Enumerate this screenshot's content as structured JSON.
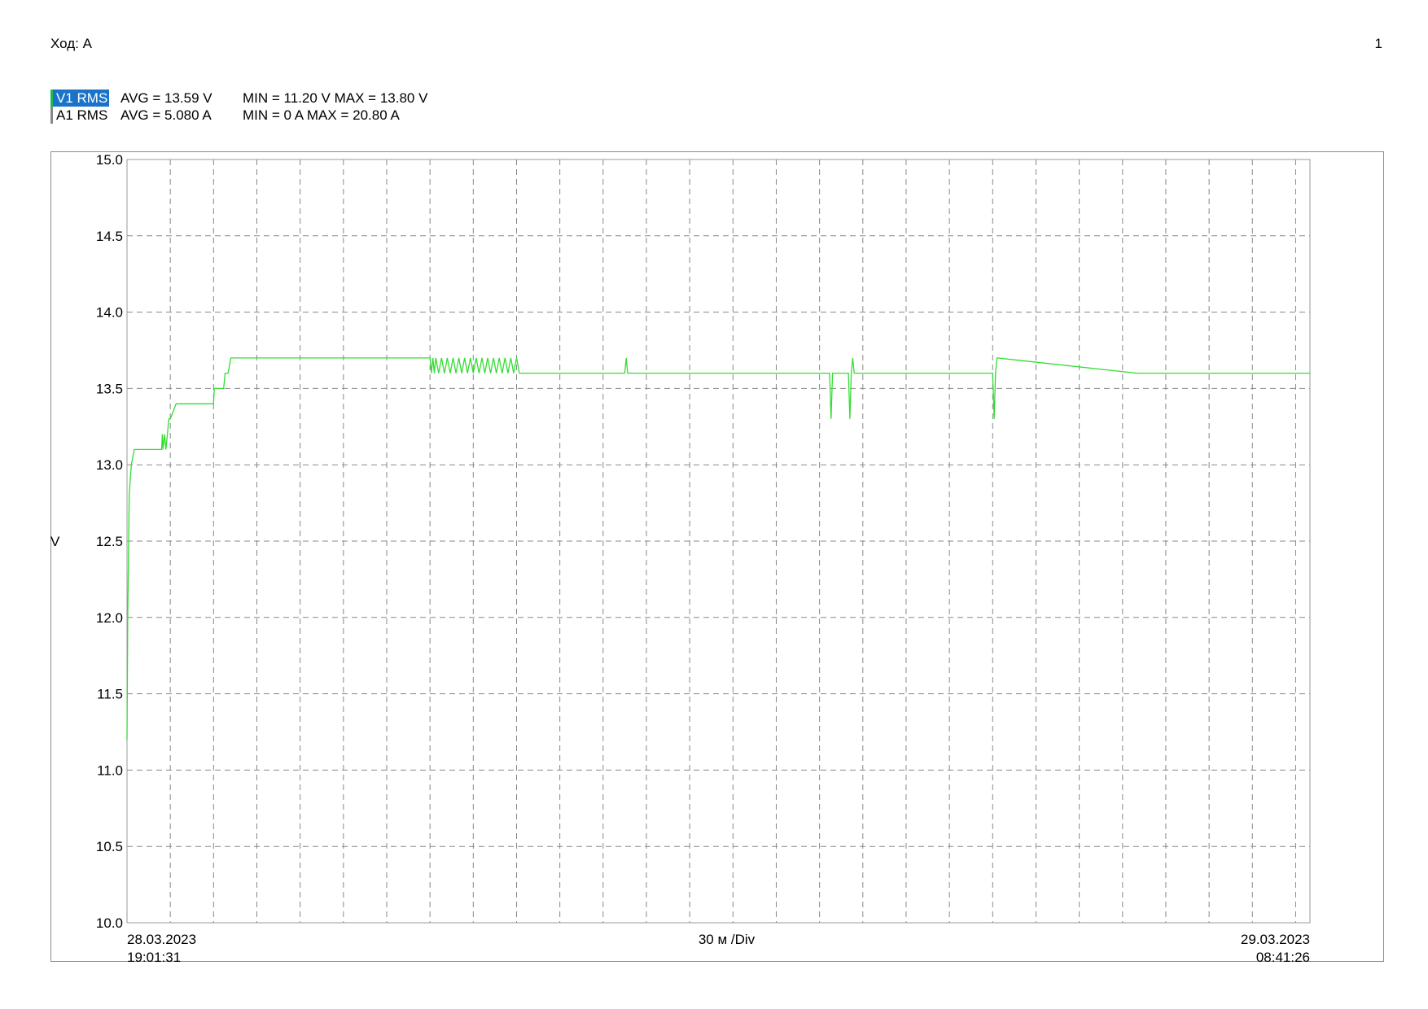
{
  "header": {
    "title": "Ход: A",
    "page_number": "1"
  },
  "legend": [
    {
      "name": "V1 RMS",
      "avg": "AVG = 13.59 V",
      "minmax": "MIN = 11.20 V MAX = 13.80 V",
      "selected": true
    },
    {
      "name": "A1 RMS",
      "avg": "AVG = 5.080 A",
      "minmax": "MIN = 0 A MAX = 20.80 A",
      "selected": false
    }
  ],
  "colors": {
    "series": "#33dd33",
    "grid": "#888888",
    "axes": "#999999",
    "selected_bg": "#1a73c8"
  },
  "chart_data": {
    "type": "line",
    "title": "",
    "ylabel": "V",
    "xlabel": "30 м /Div",
    "ylim": [
      10.0,
      15.0
    ],
    "yticks": [
      "15.0",
      "14.5",
      "14.0",
      "13.5",
      "13.0",
      "12.5",
      "12.0",
      "11.5",
      "11.0",
      "10.5",
      "10.0"
    ],
    "x_start": {
      "date": "28.03.2023",
      "time": "19:01:31"
    },
    "x_end": {
      "date": "29.03.2023",
      "time": "08:41:26"
    },
    "x_unit": "minutes after start",
    "xlim": [
      0,
      819.9
    ],
    "x_division_minutes": 30,
    "grid": true,
    "series": [
      {
        "name": "V1 RMS",
        "x": [
          0,
          0.5,
          1.5,
          3,
          5,
          6,
          6.1,
          10,
          24,
          24.5,
          25,
          26,
          27,
          28,
          29,
          30,
          34,
          37,
          39,
          40,
          41,
          42,
          43,
          44,
          46,
          60,
          60.5,
          62,
          64,
          67,
          68,
          70,
          72,
          73,
          76,
          80,
          95,
          150,
          200,
          210,
          211,
          212,
          213,
          214,
          216,
          218,
          220,
          222,
          224,
          226,
          228,
          230,
          232,
          234,
          236,
          238,
          240,
          242,
          244,
          246,
          248,
          250,
          252,
          254,
          256,
          258,
          260,
          262,
          264,
          266,
          268,
          270,
          272,
          275,
          300,
          345,
          346,
          347,
          400,
          487,
          488,
          489,
          490,
          500,
          501,
          502,
          503,
          504,
          600,
          601,
          602,
          603,
          700,
          819.9
        ],
        "values": [
          11.2,
          12.0,
          12.8,
          13.0,
          13.1,
          13.1,
          13.1,
          13.1,
          13.1,
          13.2,
          13.1,
          13.2,
          13.1,
          13.2,
          13.3,
          13.3,
          13.4,
          13.4,
          13.4,
          13.4,
          13.4,
          13.4,
          13.4,
          13.4,
          13.4,
          13.4,
          13.5,
          13.5,
          13.5,
          13.5,
          13.6,
          13.6,
          13.7,
          13.7,
          13.7,
          13.7,
          13.7,
          13.7,
          13.7,
          13.7,
          13.6,
          13.7,
          13.6,
          13.7,
          13.6,
          13.7,
          13.6,
          13.7,
          13.6,
          13.7,
          13.6,
          13.7,
          13.6,
          13.7,
          13.6,
          13.7,
          13.6,
          13.7,
          13.6,
          13.7,
          13.6,
          13.7,
          13.6,
          13.7,
          13.6,
          13.7,
          13.6,
          13.7,
          13.6,
          13.7,
          13.6,
          13.7,
          13.6,
          13.6,
          13.6,
          13.6,
          13.7,
          13.6,
          13.6,
          13.6,
          13.3,
          13.6,
          13.6,
          13.6,
          13.3,
          13.6,
          13.7,
          13.6,
          13.6,
          13.3,
          13.6,
          13.7,
          13.6,
          13.6
        ]
      }
    ]
  }
}
